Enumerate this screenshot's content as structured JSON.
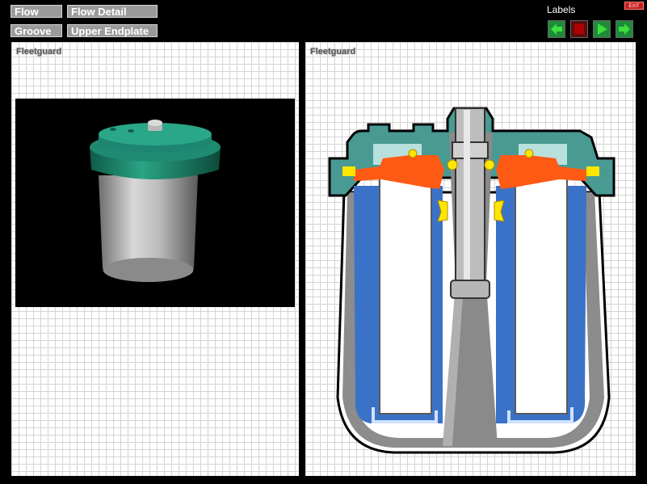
{
  "nav": {
    "flow": "Flow",
    "flow_detail": "Flow Detail",
    "groove": "Groove",
    "upper_endplate": "Upper Endplate"
  },
  "labels_title": "Labels",
  "exit_label": "EXIT",
  "controls": [
    "back-arrow-icon",
    "stop-icon",
    "play-icon",
    "forward-arrow-icon"
  ],
  "left_panel": {
    "title": "Fleetguard"
  },
  "right_panel": {
    "title": "Fleetguard"
  },
  "colors": {
    "teal": "#1f8a72",
    "orange": "#ff5a14",
    "yellow": "#ffe600",
    "blue": "#3a72c8",
    "gray": "#9a9a9a",
    "arrow_green": "#21b02b",
    "stop_red": "#b00000"
  }
}
